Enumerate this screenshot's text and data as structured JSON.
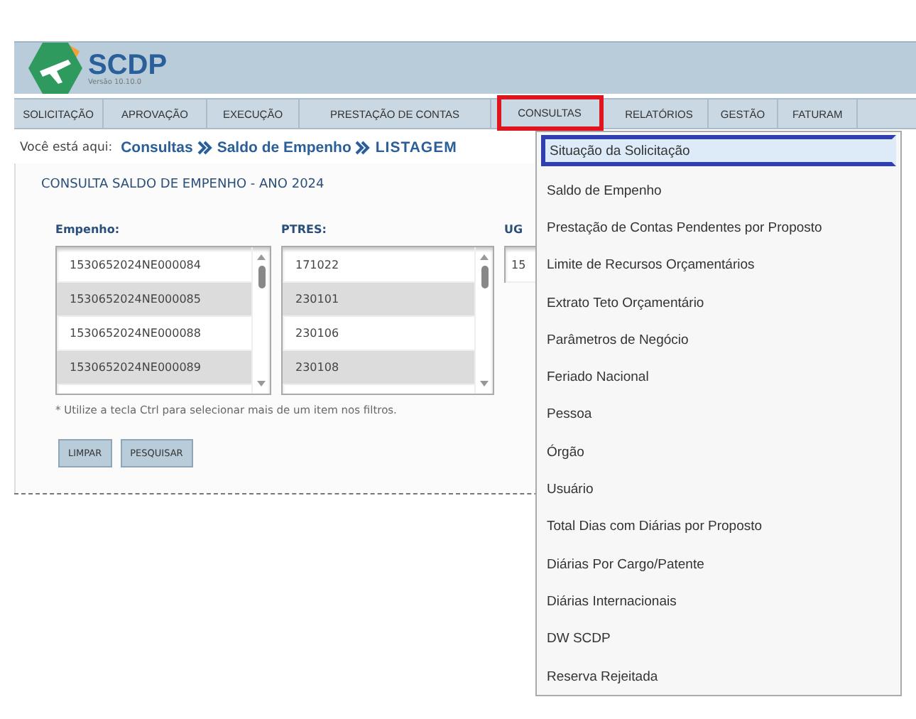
{
  "header": {
    "logo_text": "SCDP",
    "version": "Versão 10.10.0"
  },
  "nav": [
    {
      "label": "SOLICITAÇÃO",
      "selected": false
    },
    {
      "label": "APROVAÇÃO",
      "selected": false
    },
    {
      "label": "EXECUÇÃO",
      "selected": false
    },
    {
      "label": "PRESTAÇÃO DE CONTAS",
      "selected": false
    },
    {
      "label": "CONSULTAS",
      "selected": true
    },
    {
      "label": "RELATÓRIOS",
      "selected": false
    },
    {
      "label": "GESTÃO",
      "selected": false
    },
    {
      "label": "FATURAM",
      "selected": false
    }
  ],
  "breadcrumb": {
    "prefix": "Você está aqui:",
    "items": [
      "Consultas",
      "Saldo de Empenho",
      "LISTAGEM"
    ]
  },
  "panel": {
    "title": "CONSULTA SALDO DE EMPENHO - ANO 2024",
    "filters": [
      {
        "label": "Empenho:",
        "items": [
          "1530652024NE000084",
          "1530652024NE000085",
          "1530652024NE000088",
          "1530652024NE000089"
        ]
      },
      {
        "label": "PTRES:",
        "items": [
          "171022",
          "230101",
          "230106",
          "230108"
        ]
      },
      {
        "label": "UG",
        "items": [
          "15"
        ]
      }
    ],
    "hint": "* Utilize a tecla Ctrl para selecionar mais de um item nos filtros.",
    "buttons": [
      "LIMPAR",
      "PESQUISAR"
    ]
  },
  "dropdown": [
    {
      "label": "Situação da Solicitação",
      "selected": true
    },
    {
      "label": "Saldo de Empenho",
      "selected": false
    },
    {
      "label": "Prestação de Contas Pendentes por Proposto",
      "selected": false
    },
    {
      "label": "Limite de Recursos Orçamentários",
      "selected": false
    },
    {
      "label": "Extrato Teto Orçamentário",
      "selected": false
    },
    {
      "label": "Parâmetros de Negócio",
      "selected": false
    },
    {
      "label": "Feriado Nacional",
      "selected": false
    },
    {
      "label": "Pessoa",
      "selected": false
    },
    {
      "label": "Órgão",
      "selected": false
    },
    {
      "label": "Usuário",
      "selected": false
    },
    {
      "label": "Total Dias com Diárias por Proposto",
      "selected": false
    },
    {
      "label": "Diárias Por Cargo/Patente",
      "selected": false
    },
    {
      "label": "Diárias Internacionais",
      "selected": false
    },
    {
      "label": "DW SCDP",
      "selected": false
    },
    {
      "label": "Reserva Rejeitada",
      "selected": false
    }
  ]
}
